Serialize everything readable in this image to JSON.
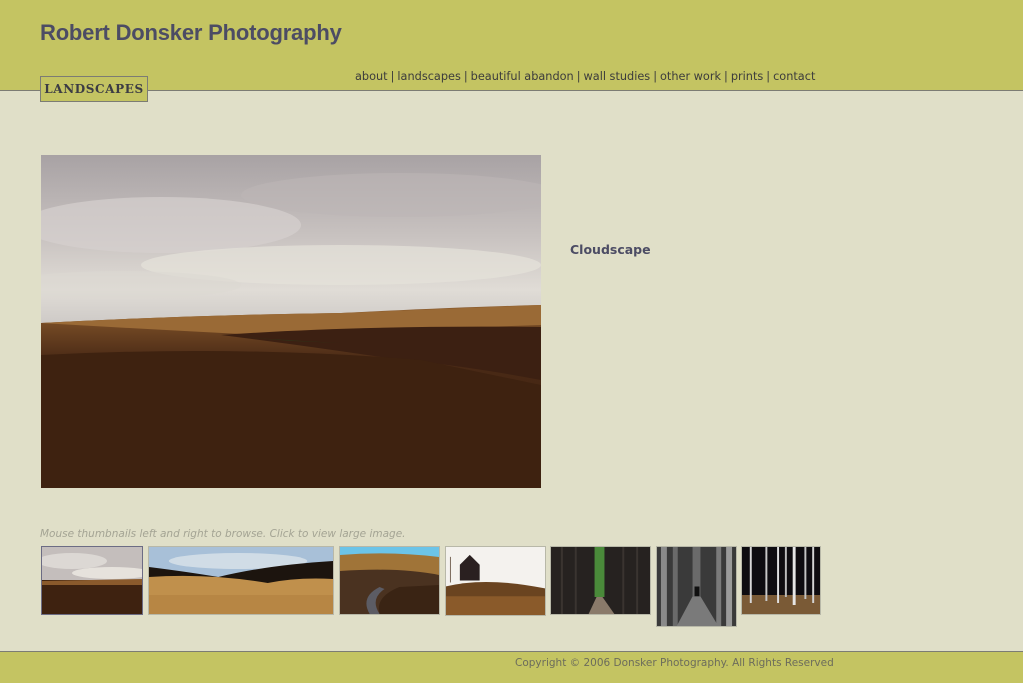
{
  "header": {
    "site_title": "Robert Donsker Photography",
    "section_badge": "LANDSCAPES"
  },
  "nav": {
    "items": [
      {
        "label": "about"
      },
      {
        "label": "landscapes"
      },
      {
        "label": "beautiful abandon"
      },
      {
        "label": "wall studies"
      },
      {
        "label": "other work"
      },
      {
        "label": "prints"
      },
      {
        "label": "contact"
      }
    ],
    "separator": "|"
  },
  "gallery": {
    "current_title": "Cloudscape",
    "hint": "Mouse thumbnails left and right to browse. Click to view large image.",
    "thumbnails": [
      {
        "subject": "cloudscape over plowed fields",
        "active": true
      },
      {
        "subject": "golden rolling hills under blue sky",
        "active": false
      },
      {
        "subject": "winding road through dark hills",
        "active": false
      },
      {
        "subject": "abandoned barn on grassy hill",
        "active": false
      },
      {
        "subject": "dark tree rows with green opening",
        "active": false
      },
      {
        "subject": "black and white tree-lined path",
        "active": false
      },
      {
        "subject": "birch trees at night",
        "active": false
      }
    ]
  },
  "footer": {
    "copyright": "Copyright © 2006 Donsker Photography. All Rights Reserved"
  },
  "colors": {
    "header_bg": "#c4c462",
    "page_bg": "#e0dfc8",
    "title_text": "#4c4c64",
    "rule": "#7c7c74"
  }
}
